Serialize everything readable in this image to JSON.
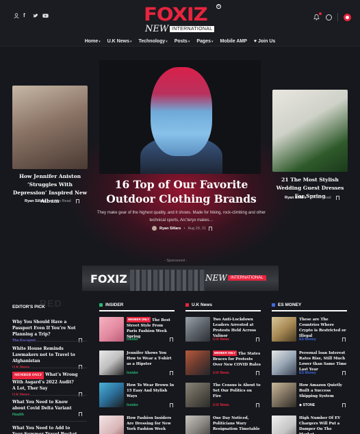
{
  "brand": {
    "name": "FOXIZ",
    "sub": "NEW",
    "tagline": "INTERNATIONAL",
    "reg": "®"
  },
  "colors": {
    "accent": "#e8243e",
    "bg": "#16181d",
    "insider": "#2bb673",
    "uknews": "#e8243e",
    "esmoney": "#4169e1",
    "health": "#2bb673",
    "escapist": "#7b6cf6"
  },
  "header_icons": [
    "user-icon",
    "facebook-icon",
    "twitter-icon",
    "youtube-icon",
    "bell-icon",
    "search-icon",
    "dark-mode-icon"
  ],
  "nav": [
    {
      "label": "Home",
      "dropdown": true
    },
    {
      "label": "U.K News",
      "dropdown": true
    },
    {
      "label": "Technology",
      "dropdown": true
    },
    {
      "label": "Posts",
      "dropdown": true
    },
    {
      "label": "Pages",
      "dropdown": true
    },
    {
      "label": "Mobile AMP",
      "dropdown": false
    },
    {
      "label": "Join Us",
      "dropdown": false,
      "icon": "heart-icon"
    }
  ],
  "hero": {
    "left": {
      "title": "How Jennifer Aniston ‘Struggles With Depression’ Inspired New Album",
      "author": "Ryan Sillars",
      "read": "6 Min Read"
    },
    "main": {
      "title": "16 Top of Our Favorite Outdoor Clothing Brands",
      "excerpt": "They make gear of the highest quality, and it shows. Made for hiking, rock-climbing and other technical sports, Arc’teryx makes…",
      "author": "Ryan Sillars",
      "date": "Aug 29, 21"
    },
    "right": {
      "title": "21 The Most Stylish Wedding Guest Dresses For Spring",
      "author": "Ryan Sillars",
      "read": "6 Min Read"
    }
  },
  "sponsored": {
    "label": "- Sponsored -",
    "banner_brand": "FOXIZ",
    "banner_new": "NEW",
    "banner_intl": "INTERNATIONAL"
  },
  "editors_pick": {
    "bg_text": "EDITOR’S PICK",
    "bg_text2": "RED",
    "title": "EDITOR'S PICK",
    "items": [
      {
        "title": "Why You Should Have a Passport Even If You’re Not Planning a Trip?",
        "category": "The Escapist",
        "tag": ""
      },
      {
        "title": "White House Reminds Lawmakers not to Travel to Afghanistan",
        "category": "U.K News",
        "tag": ""
      },
      {
        "title": "What’s Wrong With Asgard’s 2022 Audit? A Lot, Ther Say",
        "category": "U.K News",
        "tag": "MEMBER ONLY"
      },
      {
        "title": "What You Need to Know about Covid Delta Variant",
        "category": "Health",
        "tag": ""
      },
      {
        "title": "What You Need to Add to Your Summer Travel Bucket List with",
        "category": "",
        "tag": ""
      }
    ]
  },
  "columns": [
    {
      "title": "INSIDER",
      "posts": [
        {
          "title": "The Best Street Style From Paris Fashion Week Spring",
          "category": "Insider",
          "tag": "MEMBER ONLY"
        },
        {
          "title": "Jennifer Shows You How to Wear a T-shirt as a Hipster",
          "category": "Insider",
          "tag": ""
        },
        {
          "title": "How To Wear Brown In 15 Easy And Stylish Ways",
          "category": "Insider",
          "tag": ""
        },
        {
          "title": "How Fashion Insiders Are Dressing for New York Fashion Week",
          "category": "",
          "tag": ""
        }
      ]
    },
    {
      "title": "U.K News",
      "posts": [
        {
          "title": "Two Anti-Lockdown Leaders Arrested at Protests Held Across Valinor",
          "category": "U.K News",
          "tag": ""
        },
        {
          "title": "The States Braces for Protests Over New COVID Rules",
          "category": "U.K News",
          "tag": "MEMBER ONLY"
        },
        {
          "title": "The Census is About to Set Our Politics on Fire",
          "category": "U.K News",
          "tag": ""
        },
        {
          "title": "One Day Noticed, Politicians Wary Resignation Timetable",
          "category": "",
          "tag": ""
        }
      ]
    },
    {
      "title": "ES MONEY",
      "posts": [
        {
          "title": "These are The Countries Where Crypto is Restricted or Illegal",
          "category": "ES Money",
          "tag": ""
        },
        {
          "title": "Personal loan Interest Rates Rise, Still Much Lower than Same Time Last Year",
          "category": "ES Money",
          "tag": ""
        },
        {
          "title": "How Amazon Quietly Built a Success Shipping System",
          "category": "STONE",
          "tag": ""
        },
        {
          "title": "High Number Of EV Chargers Will Put a Damper On The Market",
          "category": "",
          "tag": ""
        }
      ]
    }
  ]
}
